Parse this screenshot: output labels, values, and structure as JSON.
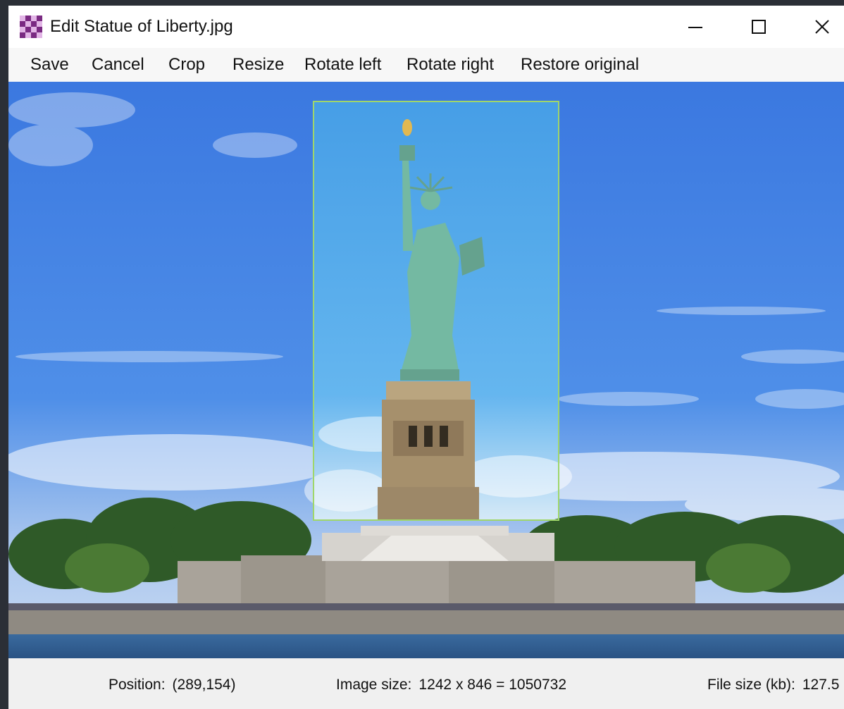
{
  "window": {
    "title": "Edit Statue of Liberty.jpg",
    "app_icon": "checkerboard-image-icon",
    "controls": {
      "minimize_icon": "minimize-icon",
      "maximize_icon": "maximize-icon",
      "close_icon": "close-icon"
    }
  },
  "menu": {
    "items": [
      {
        "label": "Save"
      },
      {
        "label": "Cancel"
      },
      {
        "label": "Crop"
      },
      {
        "label": "Resize"
      },
      {
        "label": "Rotate left"
      },
      {
        "label": "Rotate right"
      },
      {
        "label": "Restore original"
      }
    ]
  },
  "status": {
    "position_label": "Position:",
    "position_value": "(289,154)",
    "image_size_label": "Image size:",
    "image_size_value": "1242 x 846 = 1050732",
    "file_size_label": "File size (kb):",
    "file_size_value": "127.5"
  },
  "colors": {
    "sky_top": "#3f7fe0",
    "sky_bottom": "#7fb3f2",
    "crop_border": "#9fd66a",
    "statue": "#6fb79f",
    "water": "#2e5b8f",
    "trees": "#2f5a28"
  }
}
